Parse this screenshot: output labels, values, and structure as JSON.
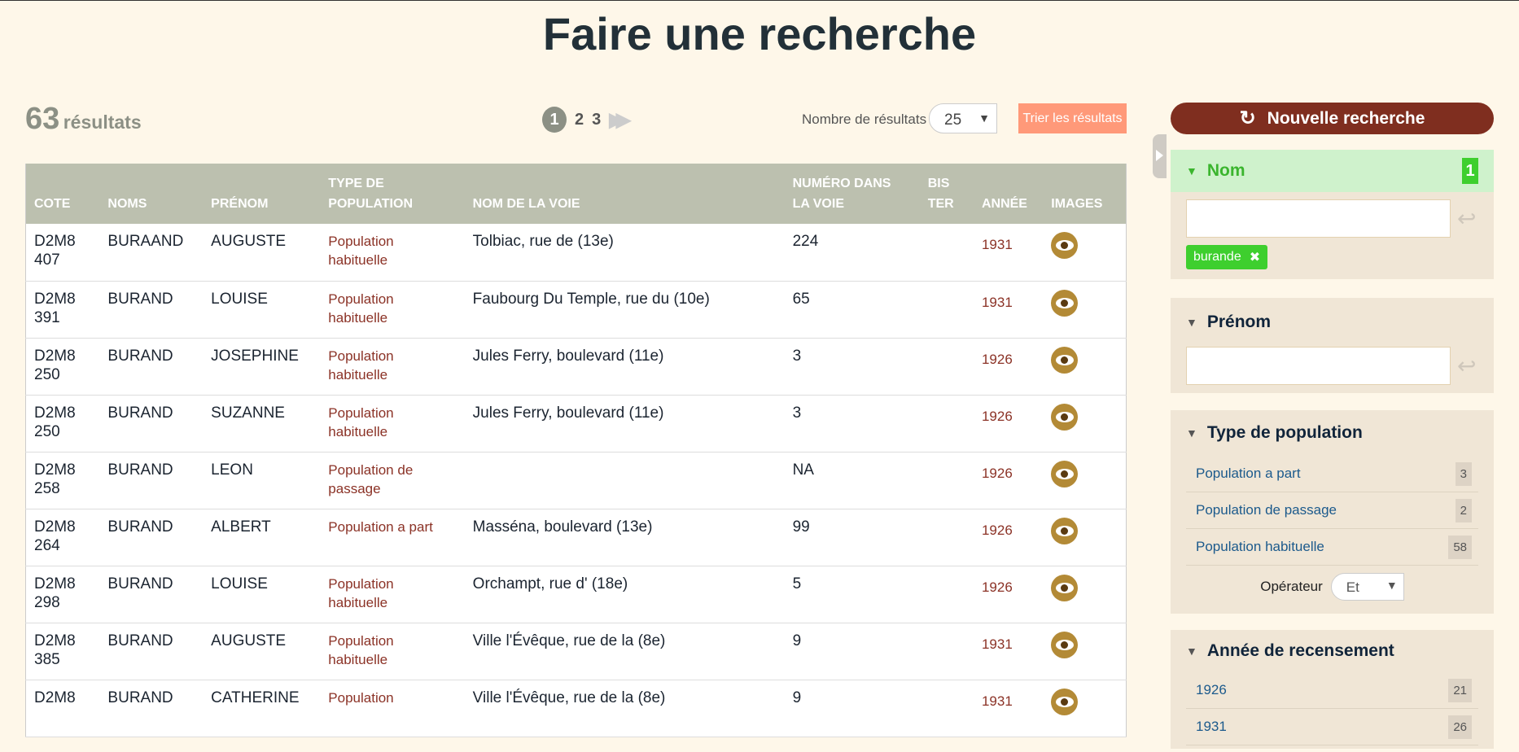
{
  "title": "Faire une recherche",
  "results": {
    "count": "63",
    "label": "résultats"
  },
  "pagination": {
    "current": "1",
    "pages": [
      "2",
      "3"
    ],
    "next_icon": "double-chevron-right-icon"
  },
  "per_page": {
    "label": "Nombre de résultats",
    "value": "25"
  },
  "sort_button": "Trier les résultats",
  "table": {
    "headers": [
      "Cote",
      "Noms",
      "Prénom",
      "Type de population",
      "Nom de la voie",
      "Numéro dans la voie",
      "Bis ter",
      "Année",
      "Images"
    ],
    "rows": [
      {
        "cote": "D2M8 407",
        "nom": "BURAAND",
        "prenom": "AUGUSTE",
        "type": "Population habituelle",
        "voie": "Tolbiac, rue de (13e)",
        "numero": "224",
        "bis": "",
        "annee": "1931"
      },
      {
        "cote": "D2M8 391",
        "nom": "BURAND",
        "prenom": "LOUISE",
        "type": "Population habituelle",
        "voie": "Faubourg Du Temple, rue du (10e)",
        "numero": "65",
        "bis": "",
        "annee": "1931"
      },
      {
        "cote": "D2M8 250",
        "nom": "BURAND",
        "prenom": "JOSEPHINE",
        "type": "Population habituelle",
        "voie": "Jules Ferry, boulevard (11e)",
        "numero": "3",
        "bis": "",
        "annee": "1926"
      },
      {
        "cote": "D2M8 250",
        "nom": "BURAND",
        "prenom": "SUZANNE",
        "type": "Population habituelle",
        "voie": "Jules Ferry, boulevard (11e)",
        "numero": "3",
        "bis": "",
        "annee": "1926"
      },
      {
        "cote": "D2M8 258",
        "nom": "BURAND",
        "prenom": "LEON",
        "type": "Population de passage",
        "voie": "",
        "numero": "NA",
        "bis": "",
        "annee": "1926"
      },
      {
        "cote": "D2M8 264",
        "nom": "BURAND",
        "prenom": "ALBERT",
        "type": "Population a part",
        "voie": "Masséna, boulevard (13e)",
        "numero": "99",
        "bis": "",
        "annee": "1926"
      },
      {
        "cote": "D2M8 298",
        "nom": "BURAND",
        "prenom": "LOUISE",
        "type": "Population habituelle",
        "voie": "Orchampt, rue d' (18e)",
        "numero": "5",
        "bis": "",
        "annee": "1926"
      },
      {
        "cote": "D2M8 385",
        "nom": "BURAND",
        "prenom": "AUGUSTE",
        "type": "Population habituelle",
        "voie": "Ville l'Évêque, rue de la (8e)",
        "numero": "9",
        "bis": "",
        "annee": "1931"
      },
      {
        "cote": "D2M8",
        "nom": "BURAND",
        "prenom": "CATHERINE",
        "type": "Population",
        "voie": "Ville l'Évêque, rue de la (8e)",
        "numero": "9",
        "bis": "",
        "annee": "1931"
      }
    ]
  },
  "sidebar": {
    "new_search": "Nouvelle recherche",
    "nom": {
      "title": "Nom",
      "badge": "1",
      "input_value": "",
      "chip": "burande"
    },
    "prenom": {
      "title": "Prénom",
      "input_value": ""
    },
    "type": {
      "title": "Type de population",
      "items": [
        {
          "label": "Population a part",
          "count": "3"
        },
        {
          "label": "Population de passage",
          "count": "2"
        },
        {
          "label": "Population habituelle",
          "count": "58"
        }
      ],
      "operator_label": "Opérateur",
      "operator_value": "Et"
    },
    "annee": {
      "title": "Année de recensement",
      "items": [
        {
          "label": "1926",
          "count": "21"
        },
        {
          "label": "1931",
          "count": "26"
        }
      ]
    }
  },
  "colors": {
    "accent": "#7f2e1f",
    "green": "#3ecf2e",
    "header": "#bcc0af",
    "sort": "#ff9979",
    "eye": "#b38a36"
  }
}
